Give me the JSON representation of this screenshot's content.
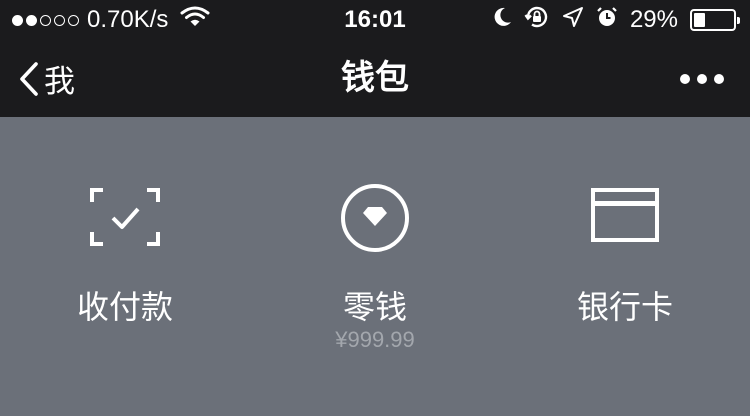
{
  "status_bar": {
    "signal_dots_filled": 2,
    "signal_dots_total": 5,
    "network_speed": "0.70K/s",
    "time": "16:01",
    "battery_percent": "29%",
    "battery_level": 0.29,
    "icons": [
      "wifi-icon",
      "moon-icon",
      "rotation-lock-icon",
      "location-arrow-icon",
      "alarm-icon",
      "battery-icon"
    ]
  },
  "nav": {
    "back_label": "我",
    "title": "钱包",
    "more_icon": "more-dots-icon"
  },
  "wallet": {
    "items": [
      {
        "label": "收付款",
        "icon": "scan-check-icon"
      },
      {
        "label": "零钱",
        "icon": "diamond-coin-icon",
        "sub": "¥999.99"
      },
      {
        "label": "银行卡",
        "icon": "bank-card-icon"
      }
    ]
  },
  "colors": {
    "header_bg": "#1b1b1d",
    "panel_bg": "#6b7079",
    "foreground": "#ffffff",
    "subtext": "#a3a7ad"
  }
}
